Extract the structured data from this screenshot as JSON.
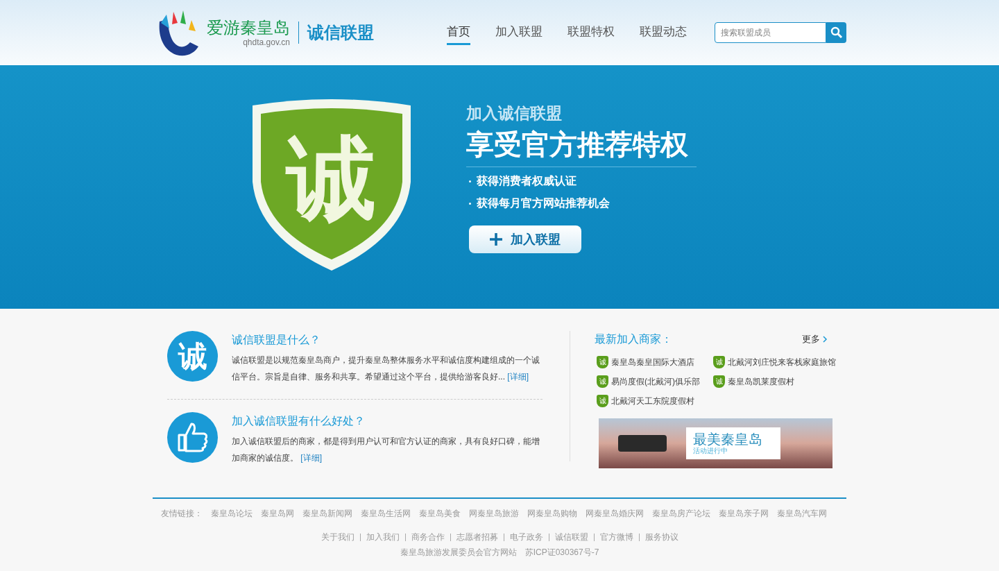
{
  "header": {
    "logo_text": "爱游秦皇岛",
    "logo_domain": "qhdta.gov.cn",
    "site_title": "诚信联盟"
  },
  "nav": [
    {
      "label": "首页",
      "selected": true
    },
    {
      "label": "加入联盟",
      "selected": false
    },
    {
      "label": "联盟特权",
      "selected": false
    },
    {
      "label": "联盟动态",
      "selected": false
    }
  ],
  "search": {
    "placeholder": "搜索联盟成员"
  },
  "hero": {
    "shield_char": "诚",
    "subtitle": "加入诚信联盟",
    "title": "享受官方推荐特权",
    "bullets": [
      "获得消费者权威认证",
      "获得每月官方网站推荐机会"
    ],
    "button": "加入联盟"
  },
  "faq": [
    {
      "kind": "char",
      "icon_char": "诚",
      "question": "诚信联盟是什么？",
      "answer": "诚信联盟是以规范秦皇岛商户，提升秦皇岛整体服务水平和诚信度构建组成的一个诚信平台。宗旨是自律、服务和共享。希望通过这个平台，提供给游客良好...",
      "link": "[详细]"
    },
    {
      "kind": "thumb",
      "question": "加入诚信联盟有什么好处？",
      "answer": "加入诚信联盟后的商家，都是得到用户认可和官方认证的商家，具有良好口碑，能增加商家的诚信度。",
      "link": "[详细]"
    }
  ],
  "merchants": {
    "title": "最新加入商家：",
    "more": "更多",
    "items": [
      {
        "badge": "诚",
        "name": "秦皇岛秦皇国际大酒店"
      },
      {
        "badge": "诚",
        "name": "北戴河刘庄悦来客栈家庭旅馆"
      },
      {
        "badge": "诚",
        "name": "易尚度假(北戴河)俱乐部"
      },
      {
        "badge": "诚",
        "name": "秦皇岛凯莱度假村"
      },
      {
        "badge": "诚",
        "name": "北戴河天工东院度假村"
      }
    ]
  },
  "promo_banner": {
    "title": "最美秦皇岛",
    "subtitle": "活动进行中"
  },
  "footer": {
    "friend_links_label": "友情链接：",
    "friend_links": [
      "秦皇岛论坛",
      "秦皇岛网",
      "秦皇岛新闻网",
      "秦皇岛生活网",
      "秦皇岛美食",
      "网秦皇岛旅游",
      "网秦皇岛购物",
      "网秦皇岛婚庆网",
      "秦皇岛房产论坛",
      "秦皇岛亲子网",
      "秦皇岛汽车网"
    ],
    "nav_links": [
      "关于我们",
      "加入我们",
      "商务合作",
      "志愿者招募",
      "电子政务",
      "诚信联盟",
      "官方微博",
      "服务协议"
    ],
    "copyright": "秦皇岛旅游发展委员会官方网站",
    "icp": "苏ICP证030367号-7"
  }
}
